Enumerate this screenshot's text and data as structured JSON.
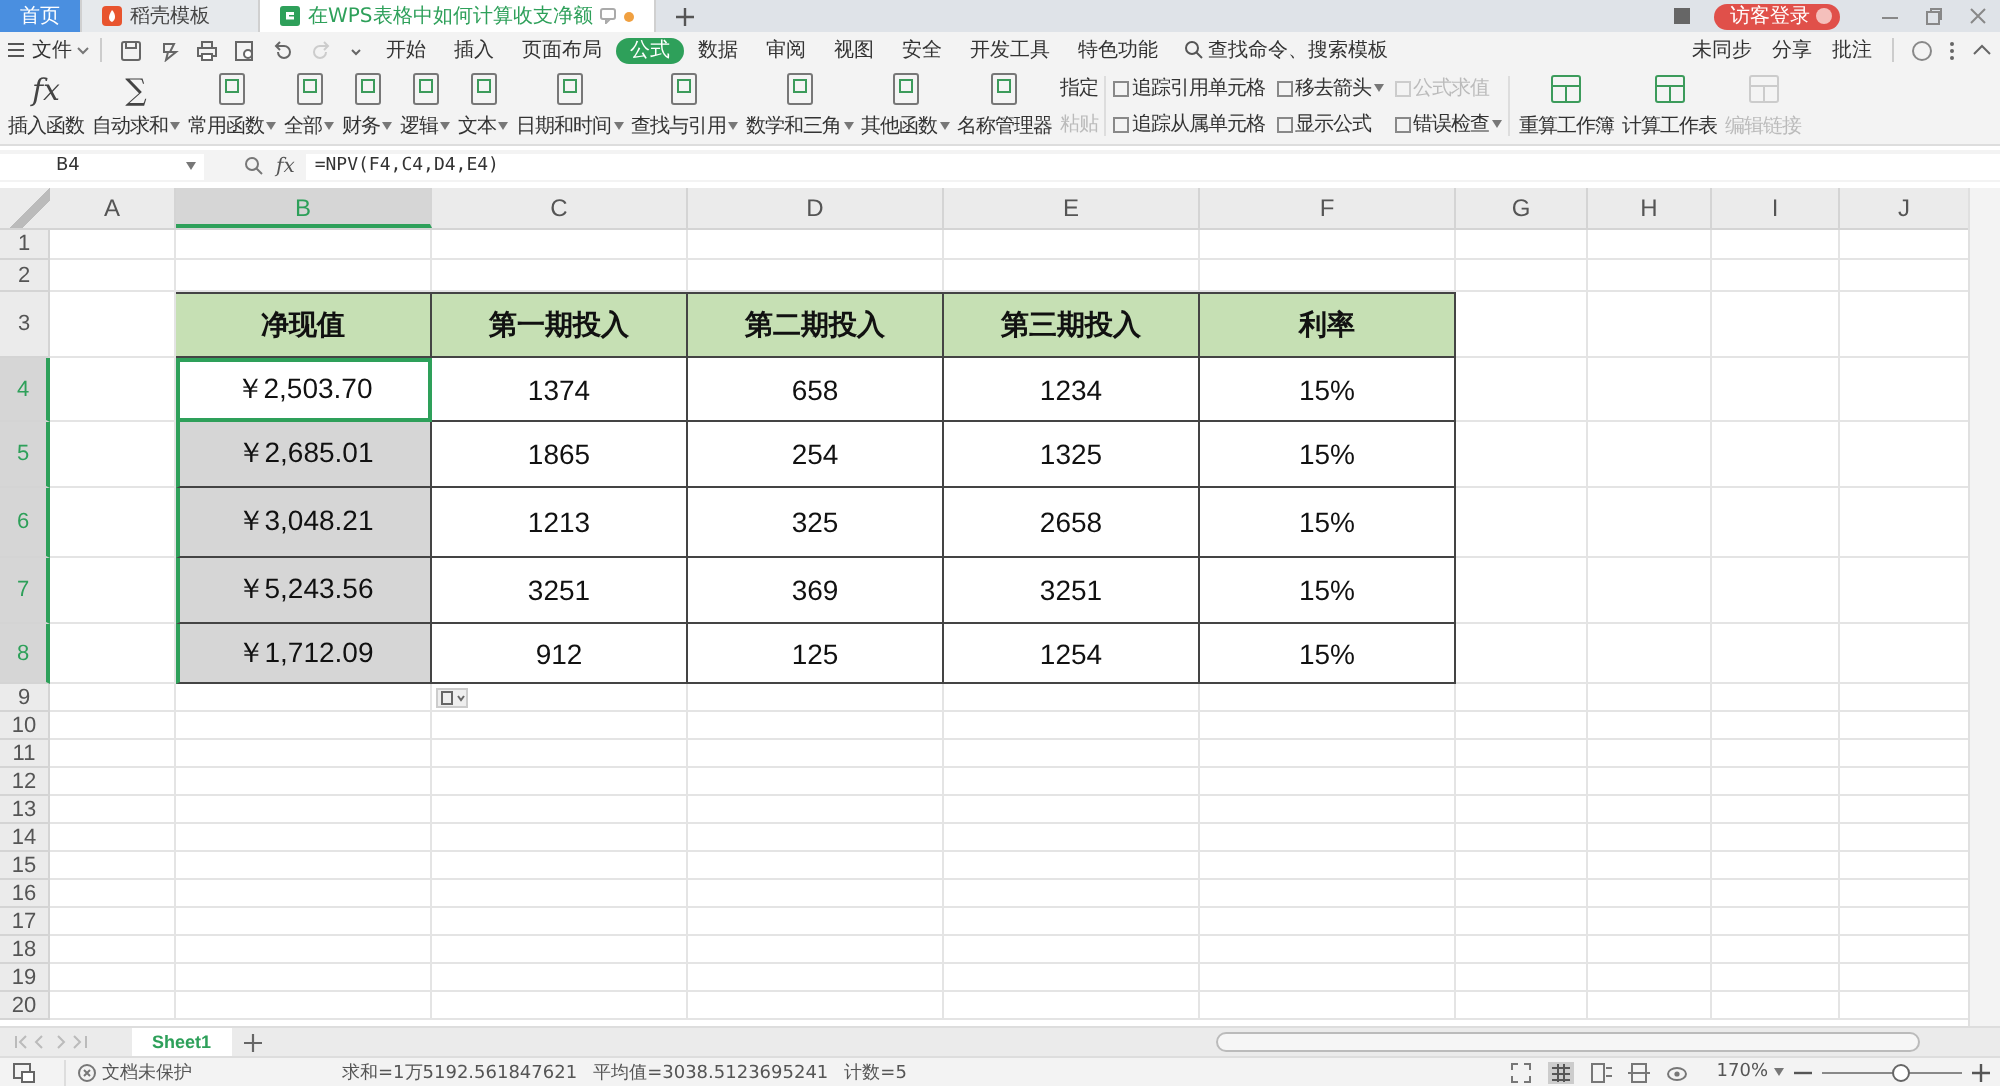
{
  "doc_tabs": [
    {
      "label": "首页",
      "kind": "home",
      "selected": false
    },
    {
      "label": "稻壳模板",
      "kind": "template",
      "selected": false
    },
    {
      "label": "在WPS表格中如何计算收支净额",
      "kind": "sheet",
      "selected": true
    }
  ],
  "login": "访客登录",
  "file_menu": "文件",
  "menu_tabs": [
    {
      "label": "开始",
      "selected": false
    },
    {
      "label": "插入",
      "selected": false
    },
    {
      "label": "页面布局",
      "selected": false
    },
    {
      "label": "公式",
      "selected": true
    },
    {
      "label": "数据",
      "selected": false
    },
    {
      "label": "审阅",
      "selected": false
    },
    {
      "label": "视图",
      "selected": false
    },
    {
      "label": "安全",
      "selected": false
    },
    {
      "label": "开发工具",
      "selected": false
    },
    {
      "label": "特色功能",
      "selected": false
    }
  ],
  "command_search": {
    "placeholder": "查找命令、搜索模板"
  },
  "right_actions": [
    "未同步",
    "分享",
    "批注"
  ],
  "ribbon_big": [
    {
      "label": "插入函数",
      "kind": "glyph",
      "glyph": "fx",
      "menu": false
    },
    {
      "label": "自动求和",
      "kind": "glyph",
      "glyph": "∑",
      "menu": true
    },
    {
      "label": "常用函数",
      "kind": "fn",
      "menu": true
    },
    {
      "label": "全部",
      "kind": "fn",
      "menu": true
    },
    {
      "label": "财务",
      "kind": "fn",
      "menu": true
    },
    {
      "label": "逻辑",
      "kind": "fn",
      "menu": true
    },
    {
      "label": "文本",
      "kind": "fn",
      "menu": true
    },
    {
      "label": "日期和时间",
      "kind": "fn",
      "menu": true
    },
    {
      "label": "查找与引用",
      "kind": "fn",
      "menu": true
    },
    {
      "label": "数学和三角",
      "kind": "fn",
      "menu": true
    },
    {
      "label": "其他函数",
      "kind": "fn",
      "menu": true
    },
    {
      "label": "名称管理器",
      "kind": "fn",
      "menu": false
    }
  ],
  "ribbon_small": [
    {
      "label": "指定",
      "disabled": false
    },
    {
      "label": "粘贴",
      "disabled": true
    },
    {
      "label": "追踪引用单元格",
      "disabled": false,
      "menu": false
    },
    {
      "label": "追踪从属单元格",
      "disabled": false,
      "menu": false
    },
    {
      "label": "移去箭头",
      "disabled": false,
      "menu": true
    },
    {
      "label": "显示公式",
      "disabled": false,
      "menu": false
    },
    {
      "label": "公式求值",
      "disabled": true,
      "menu": false
    },
    {
      "label": "错误检查",
      "disabled": false,
      "menu": true
    }
  ],
  "ribbon_calc": [
    {
      "label": "重算工作簿",
      "disabled": false
    },
    {
      "label": "计算工作表",
      "disabled": false
    },
    {
      "label": "编辑链接",
      "disabled": true
    }
  ],
  "name_box": "B4",
  "fx_label": "fx",
  "formula": "=NPV(F4,C4,D4,E4)",
  "columns": [
    {
      "label": "A",
      "selected": false
    },
    {
      "label": "B",
      "selected": true
    },
    {
      "label": "C",
      "selected": false
    },
    {
      "label": "D",
      "selected": false
    },
    {
      "label": "E",
      "selected": false
    },
    {
      "label": "F",
      "selected": false
    },
    {
      "label": "G",
      "selected": false
    },
    {
      "label": "H",
      "selected": false
    },
    {
      "label": "I",
      "selected": false
    },
    {
      "label": "J",
      "selected": false
    }
  ],
  "rows": [
    {
      "number": "1",
      "selected": false
    },
    {
      "number": "2",
      "selected": false
    },
    {
      "number": "3",
      "selected": false,
      "kind": "header",
      "cells": [
        {
          "text": "净现值",
          "selected": false
        },
        {
          "text": "第一期投入",
          "selected": false
        },
        {
          "text": "第二期投入",
          "selected": false
        },
        {
          "text": "第三期投入",
          "selected": false
        },
        {
          "text": "利率",
          "selected": false
        }
      ]
    },
    {
      "number": "4",
      "selected": true,
      "kind": "value",
      "cells": [
        {
          "text": "￥2,503.70",
          "selected": true
        },
        {
          "text": "1374",
          "selected": false
        },
        {
          "text": "658",
          "selected": false
        },
        {
          "text": "1234",
          "selected": false
        },
        {
          "text": "15%",
          "selected": false
        }
      ]
    },
    {
      "number": "5",
      "selected": true,
      "kind": "value",
      "cells": [
        {
          "text": "￥2,685.01",
          "selected": true
        },
        {
          "text": "1865",
          "selected": false
        },
        {
          "text": "254",
          "selected": false
        },
        {
          "text": "1325",
          "selected": false
        },
        {
          "text": "15%",
          "selected": false
        }
      ]
    },
    {
      "number": "6",
      "selected": true,
      "kind": "value",
      "cells": [
        {
          "text": "￥3,048.21",
          "selected": true
        },
        {
          "text": "1213",
          "selected": false
        },
        {
          "text": "325",
          "selected": false
        },
        {
          "text": "2658",
          "selected": false
        },
        {
          "text": "15%",
          "selected": false
        }
      ]
    },
    {
      "number": "7",
      "selected": true,
      "kind": "value",
      "cells": [
        {
          "text": "￥5,243.56",
          "selected": true
        },
        {
          "text": "3251",
          "selected": false
        },
        {
          "text": "369",
          "selected": false
        },
        {
          "text": "3251",
          "selected": false
        },
        {
          "text": "15%",
          "selected": false
        }
      ]
    },
    {
      "number": "8",
      "selected": true,
      "kind": "value",
      "cells": [
        {
          "text": "￥1,712.09",
          "selected": true
        },
        {
          "text": "912",
          "selected": false
        },
        {
          "text": "125",
          "selected": false
        },
        {
          "text": "1254",
          "selected": false
        },
        {
          "text": "15%",
          "selected": false
        }
      ]
    },
    {
      "number": "9",
      "selected": false
    },
    {
      "number": "10",
      "selected": false
    },
    {
      "number": "11",
      "selected": false
    },
    {
      "number": "12",
      "selected": false
    },
    {
      "number": "13",
      "selected": false
    },
    {
      "number": "14",
      "selected": false
    },
    {
      "number": "15",
      "selected": false
    },
    {
      "number": "16",
      "selected": false
    },
    {
      "number": "17",
      "selected": false
    },
    {
      "number": "18",
      "selected": false
    },
    {
      "number": "19",
      "selected": false
    },
    {
      "number": "20",
      "selected": false
    }
  ],
  "sheets": [
    {
      "label": "Sheet1",
      "selected": true
    }
  ],
  "status": {
    "protection": "文档未保护",
    "sum": "求和=1万5192.561847621",
    "average": "平均值=3038.5123695241",
    "count": "计数=5",
    "zoom": "170%"
  },
  "zoom_slider": {
    "level": 0.55
  }
}
